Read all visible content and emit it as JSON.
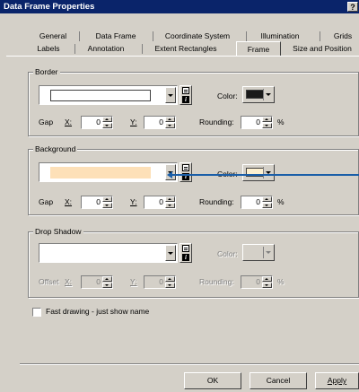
{
  "dialog": {
    "title": "Data Frame Properties",
    "help_label": "?"
  },
  "tabs_row1": [
    {
      "label": "General"
    },
    {
      "label": "Data Frame"
    },
    {
      "label": "Coordinate System"
    },
    {
      "label": "Illumination"
    },
    {
      "label": "Grids"
    }
  ],
  "tabs_row2": [
    {
      "label": "Labels"
    },
    {
      "label": "Annotation"
    },
    {
      "label": "Extent Rectangles"
    },
    {
      "label": "Frame",
      "active": true
    },
    {
      "label": "Size and Position"
    }
  ],
  "border": {
    "title": "Border",
    "color_label": "Color:",
    "color_swatch": "#1a1a1a",
    "gap_label": "Gap",
    "x_label": "X:",
    "x_value": "0",
    "y_label": "Y:",
    "y_value": "0",
    "rounding_label": "Rounding:",
    "rounding_value": "0",
    "percent": "%"
  },
  "background": {
    "title": "Background",
    "fill_color": "#fde0b8",
    "color_label": "Color:",
    "color_swatch": "#fdf0d0",
    "gap_label": "Gap",
    "x_label": "X:",
    "x_value": "0",
    "y_label": "Y:",
    "y_value": "0",
    "rounding_label": "Rounding:",
    "rounding_value": "0",
    "percent": "%"
  },
  "drop_shadow": {
    "title": "Drop Shadow",
    "color_label": "Color:",
    "offset_label": "Offset",
    "x_label": "X:",
    "x_value": "0",
    "y_label": "Y:",
    "y_value": "0",
    "rounding_label": "Rounding:",
    "rounding_value": "0",
    "percent": "%"
  },
  "fast_drawing": {
    "label": "Fast drawing - just show name",
    "checked": false
  },
  "buttons": {
    "ok": "OK",
    "cancel": "Cancel",
    "apply": "Apply"
  },
  "colors": {
    "titlebar": "#0a246a",
    "face": "#d4d0c8",
    "callout_arrow": "#1a5ea8"
  }
}
